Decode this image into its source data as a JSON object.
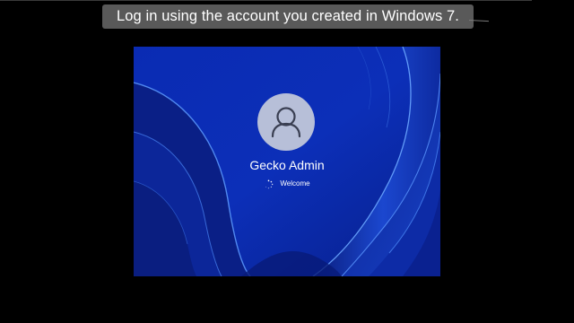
{
  "caption": {
    "text": "Log in using the account you created in Windows 7."
  },
  "login": {
    "user_name": "Gecko Admin",
    "status_text": "Welcome",
    "avatar_icon": "user-icon",
    "spinner_icon": "loading-spinner-icon"
  },
  "colors": {
    "wallpaper_base": "#0b2aa8",
    "wallpaper_highlight": "#4f8fff",
    "avatar_bg": "#b7bfd8",
    "caption_bg": "#595959"
  }
}
